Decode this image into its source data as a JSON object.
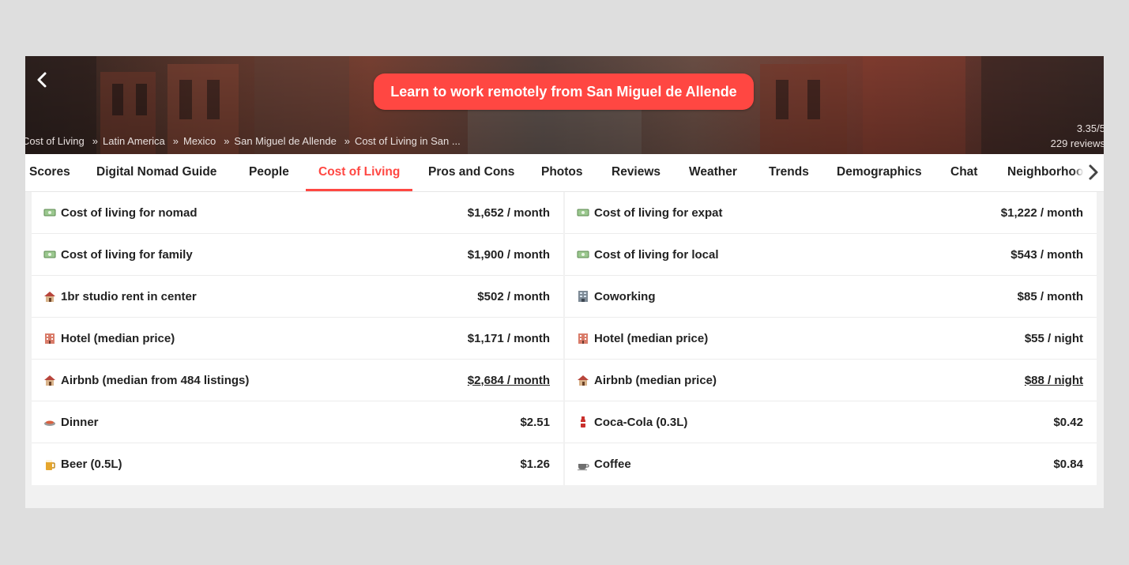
{
  "hero": {
    "cta_label": "Learn to work remotely from San Miguel de Allende",
    "breadcrumb": [
      "Cost of Living",
      "Latin America",
      "Mexico",
      "San Miguel de Allende",
      "Cost of Living in San ..."
    ],
    "breadcrumb_sep": "»",
    "rating": "3.35/5",
    "reviews": "229 reviews"
  },
  "tabs": [
    "Scores",
    "Digital Nomad Guide",
    "People",
    "Cost of Living",
    "Pros and Cons",
    "Photos",
    "Reviews",
    "Weather",
    "Trends",
    "Demographics",
    "Chat",
    "Neighborhoods"
  ],
  "active_tab": "Cost of Living",
  "colors": {
    "accent": "#ff4742",
    "text": "#222222"
  },
  "left_rows": [
    {
      "icon": "money-icon",
      "label": "Cost of living for nomad",
      "value": "$1,652 / month"
    },
    {
      "icon": "money-icon",
      "label": "Cost of living for family",
      "value": "$1,900 / month"
    },
    {
      "icon": "house-icon",
      "label": "1br studio rent in center",
      "value": "$502 / month"
    },
    {
      "icon": "hotel-icon",
      "label": "Hotel (median price)",
      "value": "$1,171 / month"
    },
    {
      "icon": "house-icon",
      "label": "Airbnb (median from 484 listings)",
      "value": "$2,684 / month",
      "link": true
    },
    {
      "icon": "dinner-icon",
      "label": "Dinner",
      "value": "$2.51"
    },
    {
      "icon": "beer-icon",
      "label": "Beer (0.5L)",
      "value": "$1.26"
    }
  ],
  "right_rows": [
    {
      "icon": "money-icon",
      "label": "Cost of living for expat",
      "value": "$1,222 / month"
    },
    {
      "icon": "money-icon",
      "label": "Cost of living for local",
      "value": "$543 / month"
    },
    {
      "icon": "office-icon",
      "label": "Coworking",
      "value": "$85 / month"
    },
    {
      "icon": "hotel-icon",
      "label": "Hotel (median price)",
      "value": "$55 / night"
    },
    {
      "icon": "house-icon",
      "label": "Airbnb (median price)",
      "value": "$88 / night",
      "link": true
    },
    {
      "icon": "soda-icon",
      "label": "Coca-Cola (0.3L)",
      "value": "$0.42"
    },
    {
      "icon": "coffee-icon",
      "label": "Coffee",
      "value": "$0.84"
    }
  ]
}
